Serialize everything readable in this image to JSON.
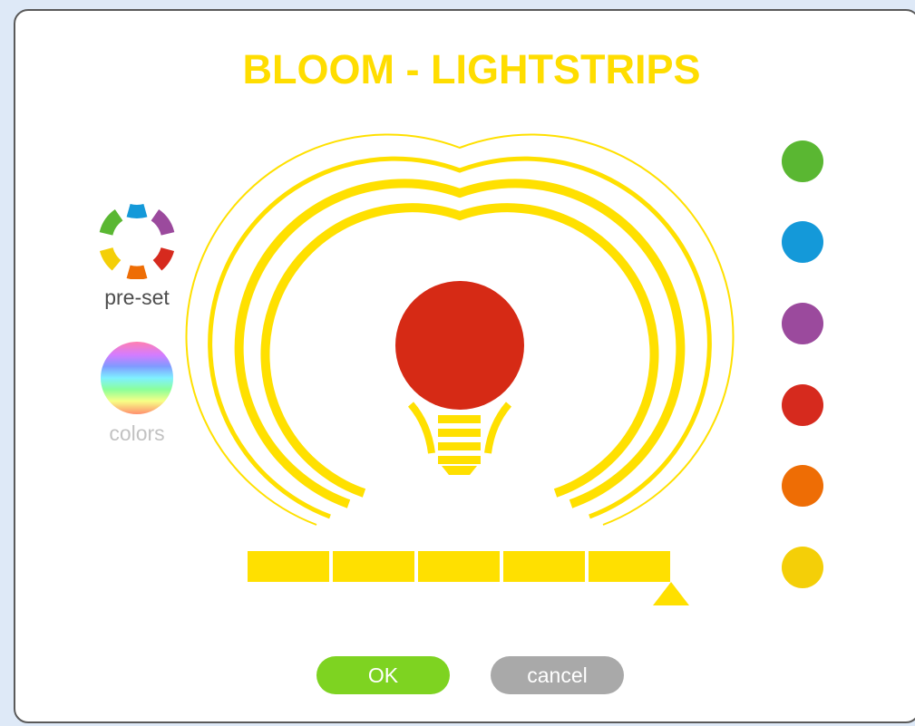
{
  "dialog": {
    "title": "BLOOM - LIGHTSTRIPS"
  },
  "modes": {
    "preset_label": "pre-set",
    "colors_label": "colors"
  },
  "bulb": {
    "color": "#d62a15",
    "glow_color": "#ffe000"
  },
  "swatches": [
    {
      "name": "green",
      "color": "#5ab732"
    },
    {
      "name": "blue",
      "color": "#1499d9"
    },
    {
      "name": "purple",
      "color": "#9b4a9d"
    },
    {
      "name": "red",
      "color": "#d62a1e"
    },
    {
      "name": "orange",
      "color": "#ee6d05"
    },
    {
      "name": "yellow",
      "color": "#f4cf08"
    }
  ],
  "brightness": {
    "segments_total": 5,
    "level": 1.0
  },
  "actions": {
    "ok_label": "OK",
    "ok_color": "#7ed321",
    "cancel_label": "cancel",
    "cancel_color": "#a9a9a9"
  },
  "colors": {
    "accent": "#ffdd00",
    "background": "#dee9f7"
  }
}
